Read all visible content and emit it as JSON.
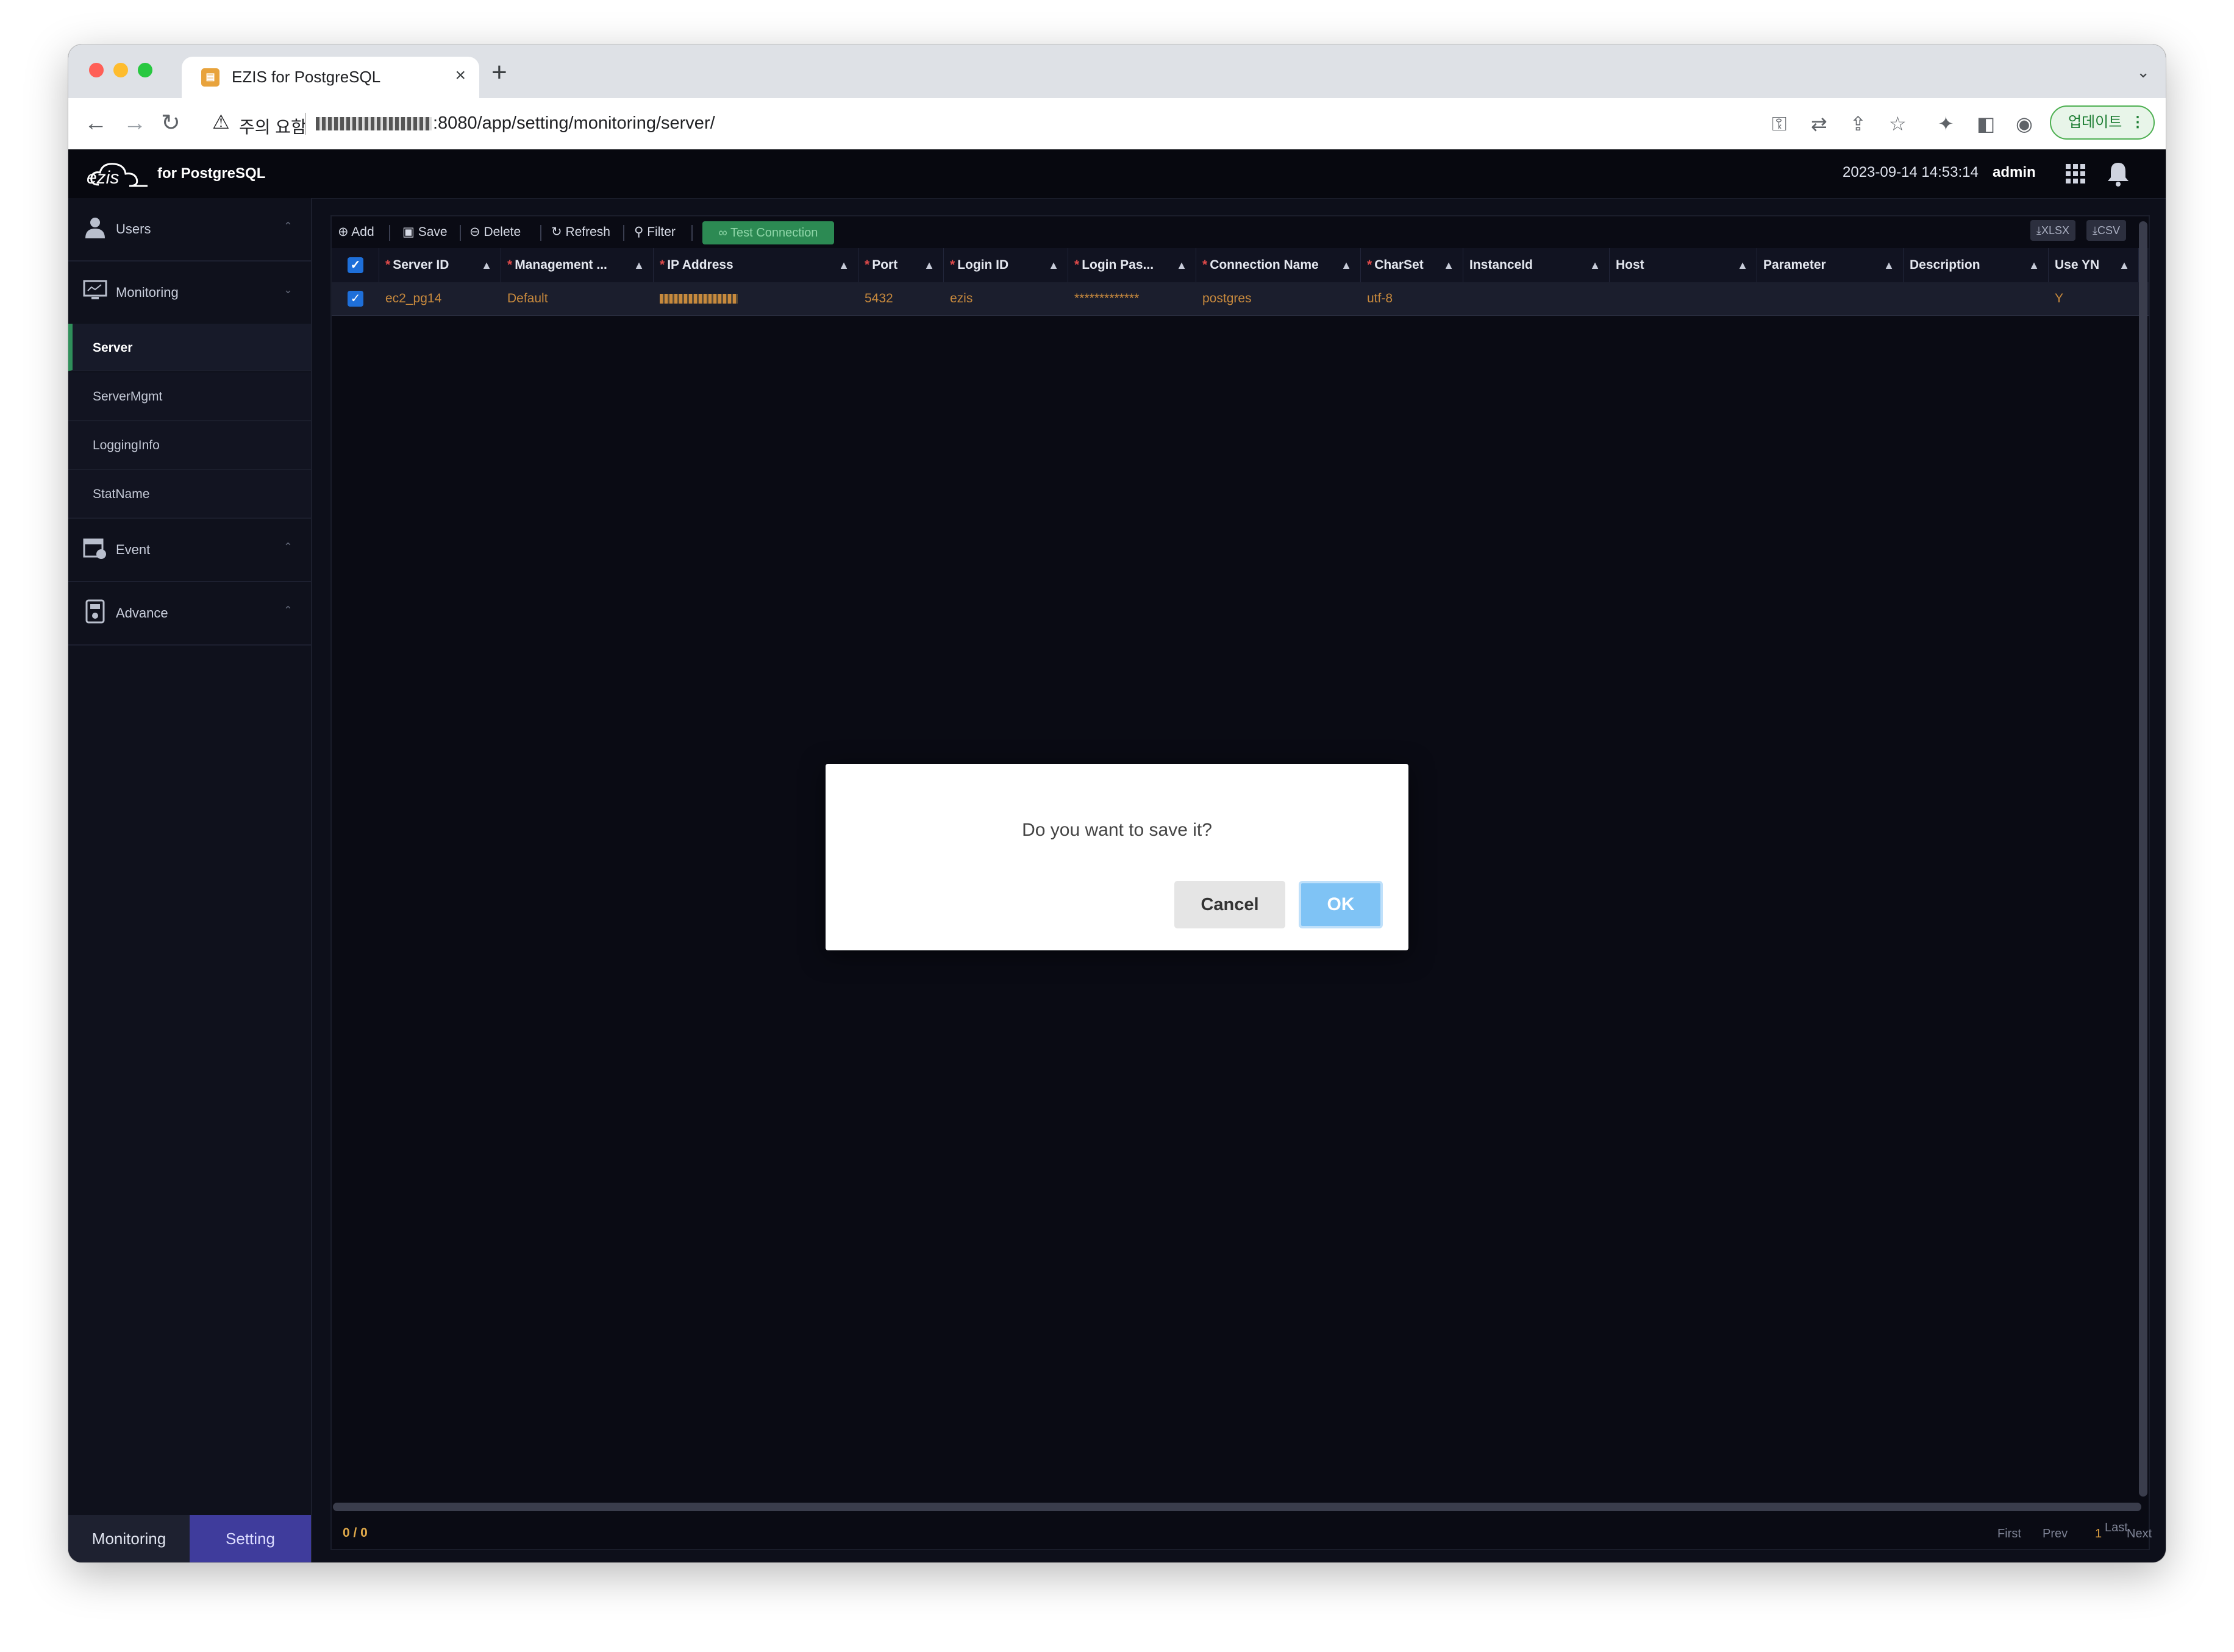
{
  "browser": {
    "tab_title": "EZIS for PostgreSQL",
    "tab_close": "×",
    "new_tab": "+",
    "security_label": "주의 요함",
    "url": ":8080/app/setting/monitoring/server/",
    "update_label": "업데이트"
  },
  "header": {
    "logo_text": "ezis",
    "brand": "for PostgreSQL",
    "datetime": "2023-09-14 14:53:14",
    "user": "admin"
  },
  "sidebar": {
    "groups": [
      {
        "label": "Users",
        "icon": "user-icon"
      },
      {
        "label": "Monitoring",
        "icon": "monitor-icon"
      },
      {
        "label": "Event",
        "icon": "event-icon"
      },
      {
        "label": "Advance",
        "icon": "advance-icon"
      }
    ],
    "monitoring_items": [
      "Server",
      "ServerMgmt",
      "LoggingInfo",
      "StatName"
    ],
    "active_item": "Server",
    "bottom_tabs": [
      "Monitoring",
      "Setting"
    ]
  },
  "toolbar": {
    "add": "Add",
    "save": "Save",
    "delete": "Delete",
    "refresh": "Refresh",
    "filter": "Filter",
    "test_connection": "Test Connection",
    "export_xlsx": "XLSX",
    "export_csv": "CSV"
  },
  "grid": {
    "columns": [
      "Server ID",
      "Management ...",
      "IP Address",
      "Port",
      "Login ID",
      "Login Pas...",
      "Connection Name",
      "CharSet",
      "InstanceId",
      "Host",
      "Parameter",
      "Description",
      "Use YN"
    ],
    "rows": [
      {
        "server_id": "ec2_pg14",
        "management": "Default",
        "port": "5432",
        "login_id": "ezis",
        "login_password": "*************",
        "connection_name": "postgres",
        "charset": "utf-8",
        "use_yn": "Y"
      }
    ]
  },
  "footer": {
    "count": "0 / 0",
    "first": "First",
    "prev": "Prev",
    "page": "1",
    "next": "Next",
    "last": "Last"
  },
  "modal": {
    "message": "Do you want to save it?",
    "cancel": "Cancel",
    "ok": "OK"
  },
  "colors": {
    "accent_green": "#2c8a53",
    "ok_button": "#7fc3f5",
    "setting_tab": "#3f3c9c",
    "cell_text": "#c7893d"
  }
}
